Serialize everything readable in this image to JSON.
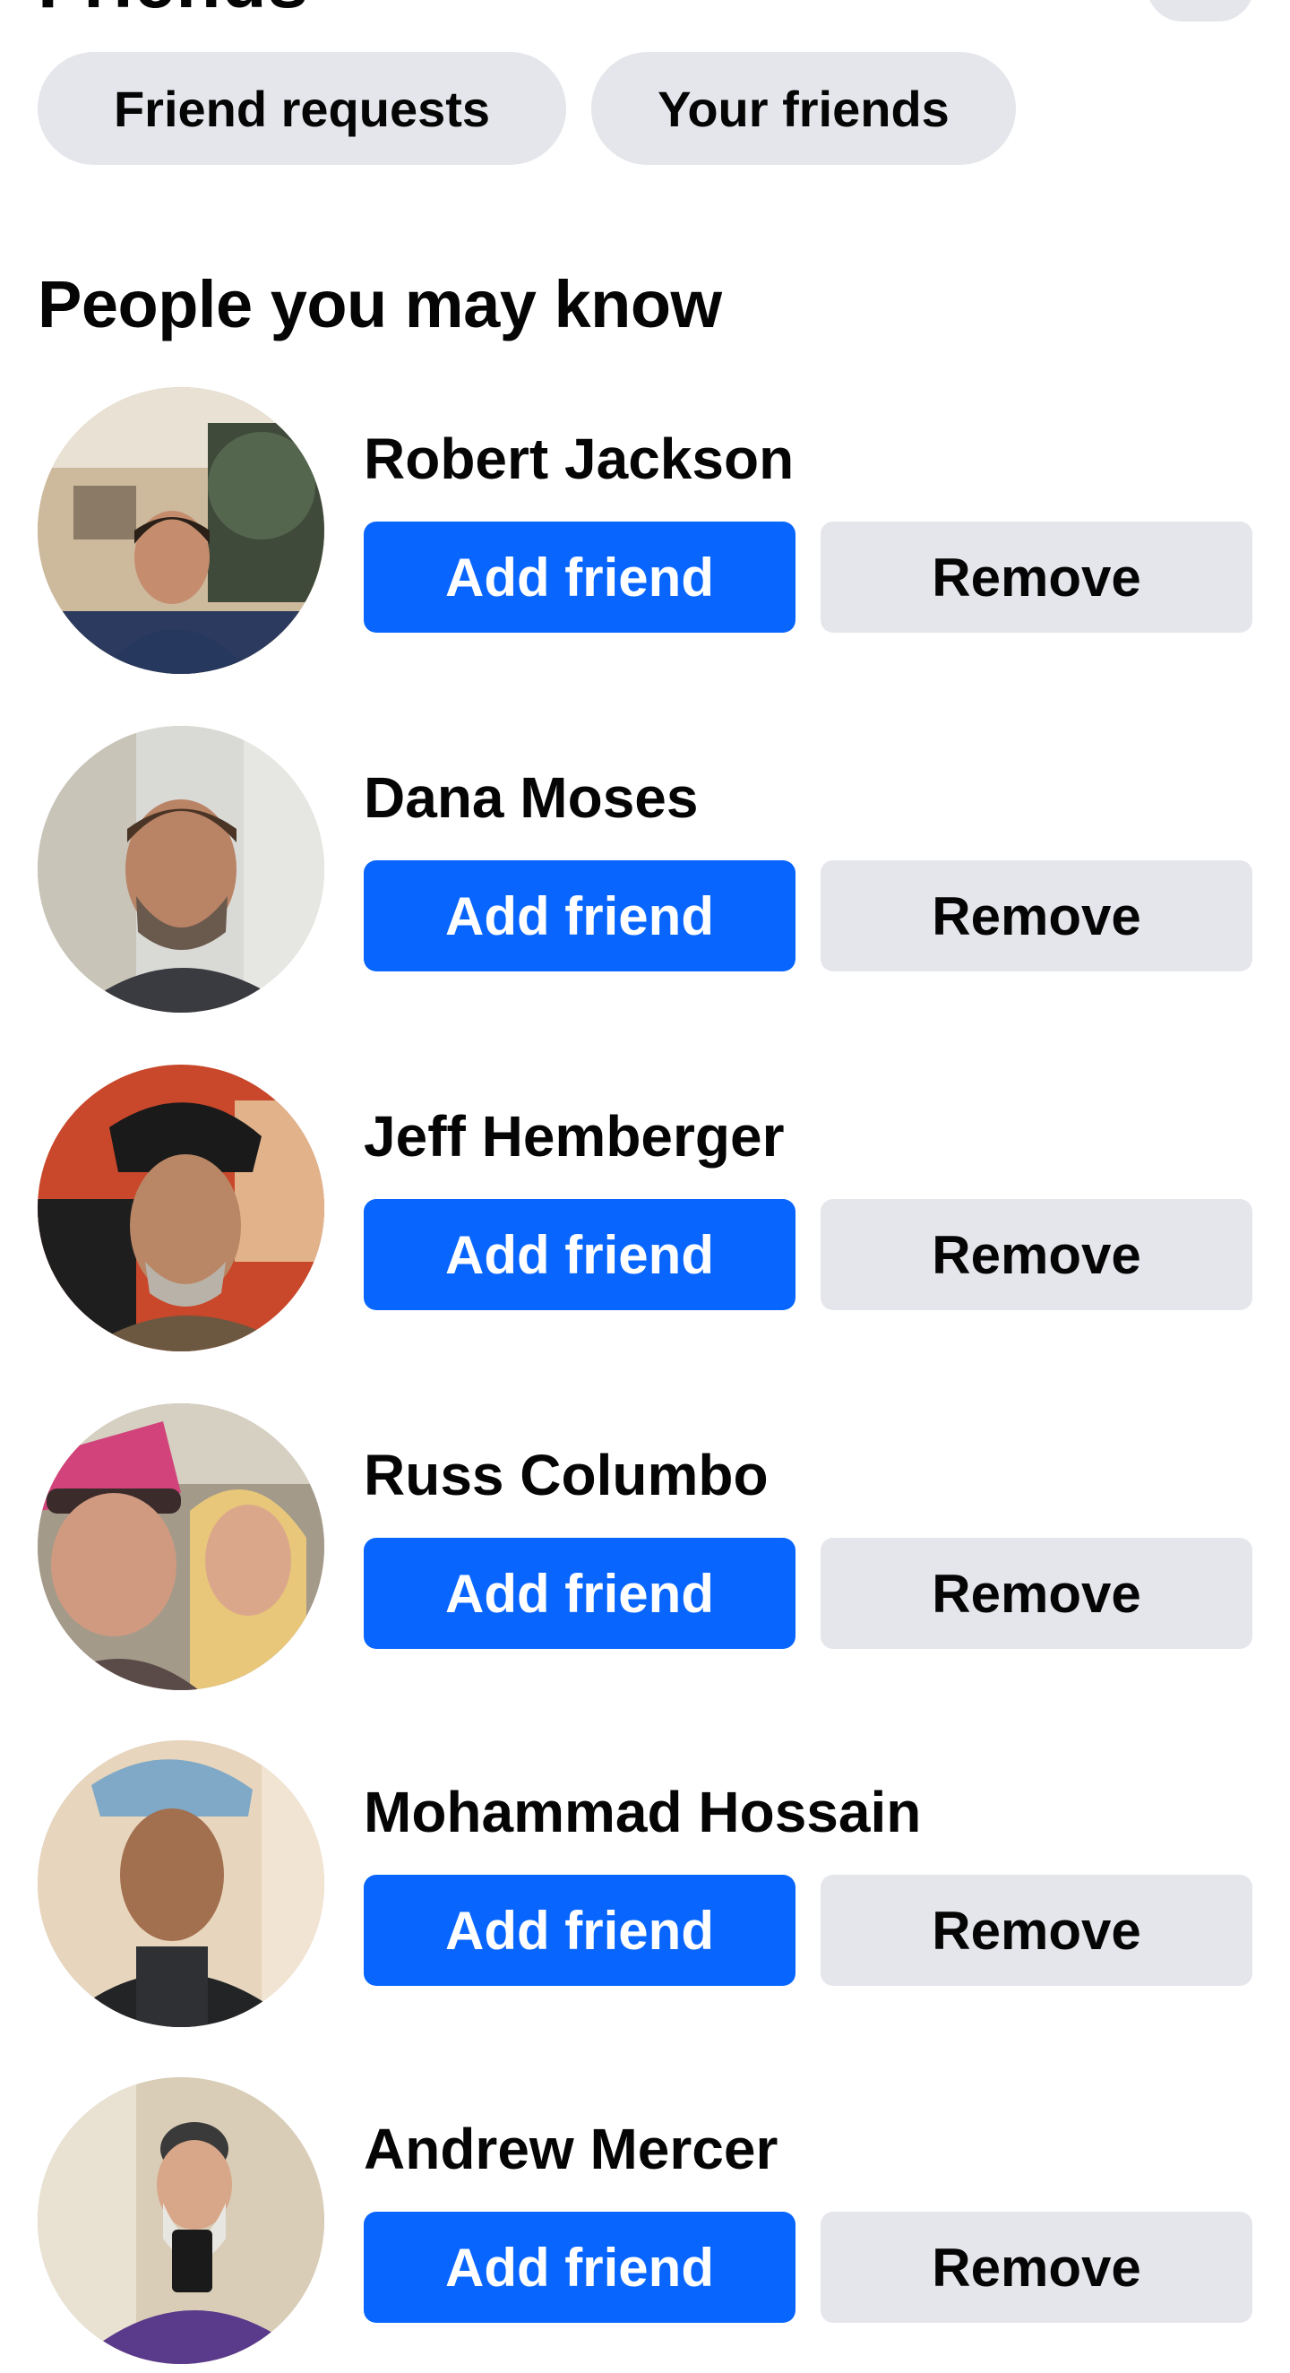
{
  "header": {
    "title": "Friends"
  },
  "chips": {
    "friend_requests": "Friend requests",
    "your_friends": "Your friends"
  },
  "section": {
    "title": "People you may know"
  },
  "people": [
    {
      "name": "Robert Jackson",
      "add_label": "Add friend",
      "remove_label": "Remove"
    },
    {
      "name": "Dana Moses",
      "add_label": "Add friend",
      "remove_label": "Remove"
    },
    {
      "name": "Jeff Hemberger",
      "add_label": "Add friend",
      "remove_label": "Remove"
    },
    {
      "name": "Russ Columbo",
      "add_label": "Add friend",
      "remove_label": "Remove"
    },
    {
      "name": "Mohammad Hossain",
      "add_label": "Add friend",
      "remove_label": "Remove"
    },
    {
      "name": "Andrew Mercer",
      "add_label": "Add friend",
      "remove_label": "Remove"
    }
  ],
  "colors": {
    "primary": "#0866ff",
    "secondary_button": "#e4e6eb",
    "text": "#050505",
    "background": "#ffffff"
  }
}
